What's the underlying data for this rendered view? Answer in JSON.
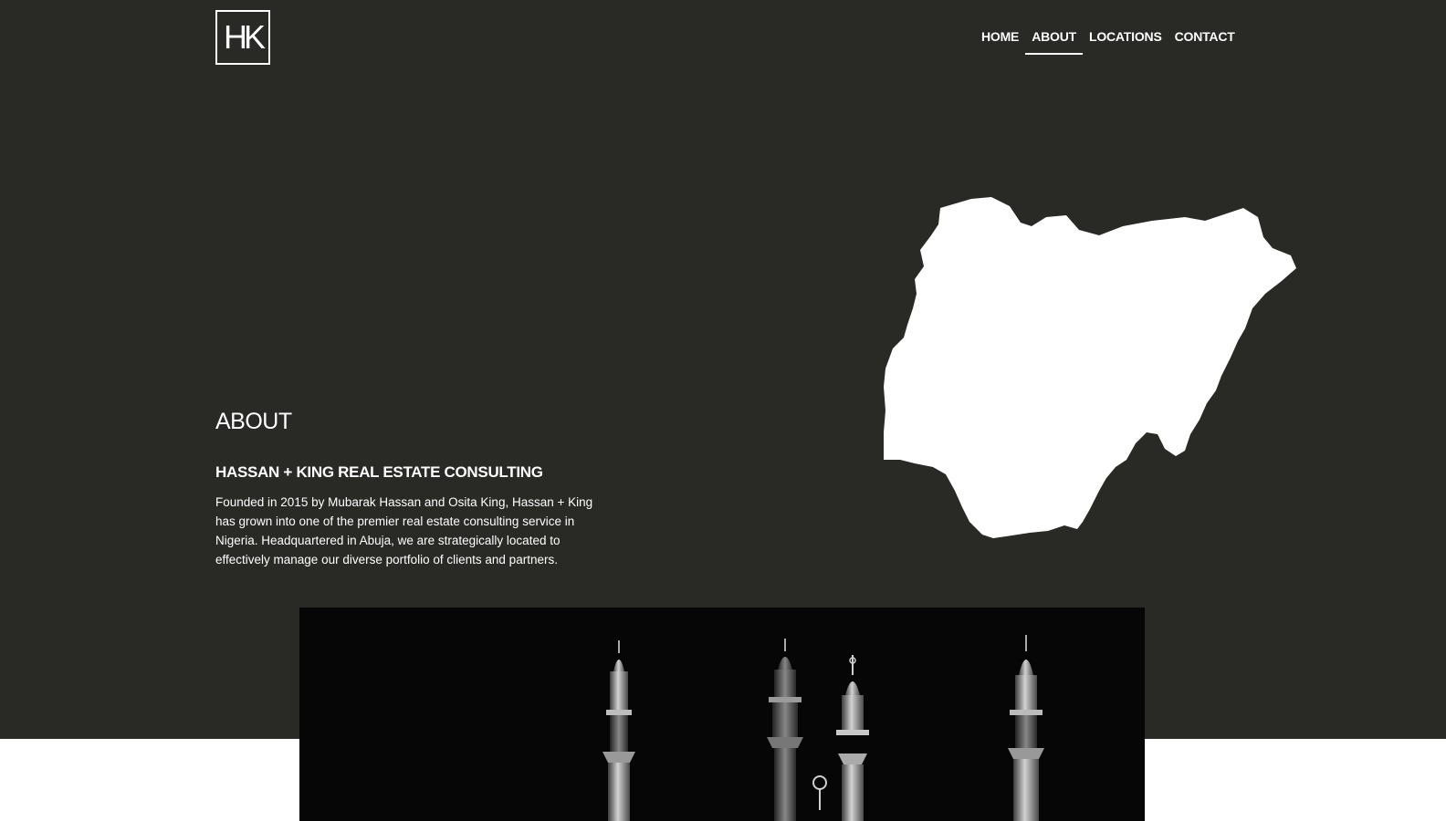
{
  "header": {
    "logo_text": "HK",
    "nav": [
      {
        "label": "HOME",
        "active": false
      },
      {
        "label": "ABOUT",
        "active": true
      },
      {
        "label": "LOCATIONS",
        "active": false
      },
      {
        "label": "CONTACT",
        "active": false
      }
    ]
  },
  "about": {
    "title": "ABOUT",
    "heading": "HASSAN + KING REAL ESTATE CONSULTING",
    "description": "Founded in 2015 by Mubarak Hassan and Osita King, Hassan + King has grown into one of the premier real estate consulting service in Nigeria. Headquartered in Abuja, we are strategically located to effectively manage our diverse portfolio of clients and partners."
  },
  "colors": {
    "hero_background": "#292925",
    "text": "#ffffff",
    "page_background": "#ffffff"
  },
  "icons": {
    "logo": "hk-logo",
    "map": "nigeria-map-silhouette",
    "photo": "mosque-minarets-photo"
  }
}
